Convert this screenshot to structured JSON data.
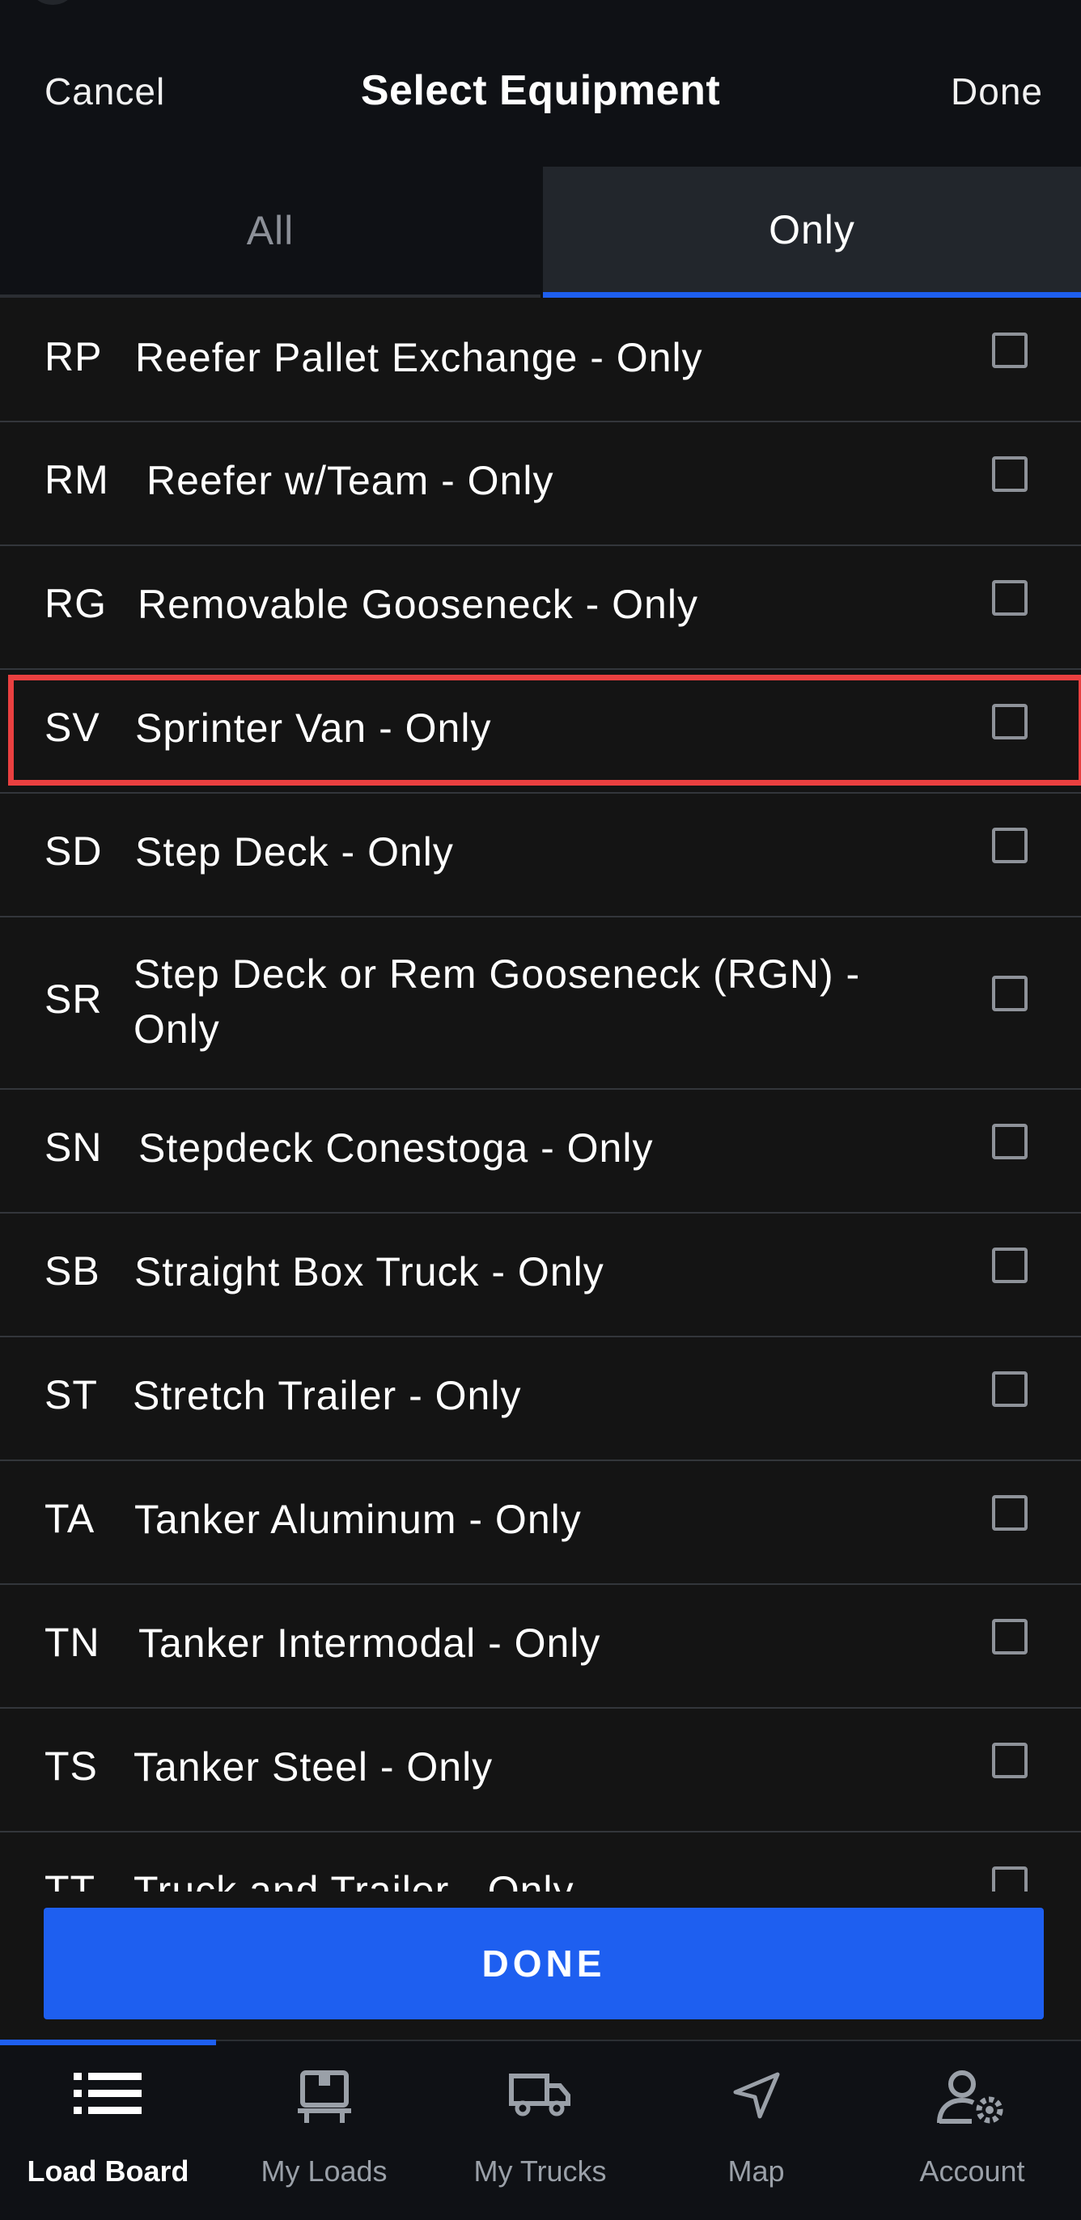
{
  "header": {
    "cancel_label": "Cancel",
    "title": "Select Equipment",
    "done_label": "Done"
  },
  "tabs": [
    {
      "label": "All",
      "active": false
    },
    {
      "label": "Only",
      "active": true
    }
  ],
  "equipment": [
    {
      "code": "RP",
      "name": "Reefer Pallet Exchange - Only",
      "checked": false
    },
    {
      "code": "RM",
      "name": "Reefer w/Team - Only",
      "checked": false
    },
    {
      "code": "RG",
      "name": "Removable Gooseneck - Only",
      "checked": false
    },
    {
      "code": "SV",
      "name": "Sprinter Van - Only",
      "checked": false,
      "highlighted": true
    },
    {
      "code": "SD",
      "name": "Step Deck - Only",
      "checked": false
    },
    {
      "code": "SR",
      "name": "Step Deck or Rem Gooseneck (RGN) - Only",
      "checked": false
    },
    {
      "code": "SN",
      "name": "Stepdeck Conestoga - Only",
      "checked": false
    },
    {
      "code": "SB",
      "name": "Straight Box Truck - Only",
      "checked": false
    },
    {
      "code": "ST",
      "name": "Stretch Trailer - Only",
      "checked": false
    },
    {
      "code": "TA",
      "name": "Tanker Aluminum - Only",
      "checked": false
    },
    {
      "code": "TN",
      "name": "Tanker Intermodal - Only",
      "checked": false
    },
    {
      "code": "TS",
      "name": "Tanker Steel - Only",
      "checked": false
    },
    {
      "code": "TT",
      "name": "Truck and Trailer - Only",
      "checked": false
    }
  ],
  "done_button_label": "DONE",
  "nav": [
    {
      "label": "Load Board",
      "icon": "list-icon",
      "active": true
    },
    {
      "label": "My Loads",
      "icon": "loads-icon",
      "active": false
    },
    {
      "label": "My Trucks",
      "icon": "truck-icon",
      "active": false
    },
    {
      "label": "Map",
      "icon": "navigation-arrow-icon",
      "active": false
    },
    {
      "label": "Account",
      "icon": "account-settings-icon",
      "active": false
    }
  ],
  "colors": {
    "accent": "#1e5ff0",
    "highlight": "#ea4040",
    "background": "#141414"
  }
}
